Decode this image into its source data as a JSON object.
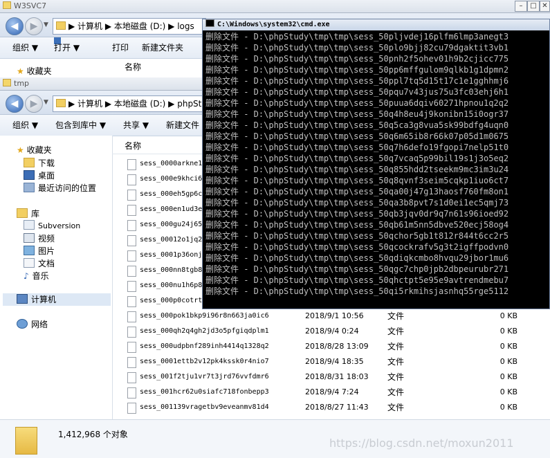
{
  "back_window": {
    "title": "W3SVC7",
    "address": "▶ 计算机 ▶ 本地磁盘 (D:) ▶ logs",
    "toolbar": {
      "organize": "组织 ▼",
      "open": "打开 ▼",
      "print": "打印",
      "new_folder": "新建文件夹"
    },
    "nav_favorites": "收藏夹",
    "col_name": "名称"
  },
  "front_window": {
    "title": "tmp",
    "address": "▶ 计算机 ▶ 本地磁盘 (D:) ▶ phpSt",
    "toolbar": {
      "organize": "组织 ▼",
      "include_lib": "包含到库中 ▼",
      "share": "共享 ▼",
      "new_folder": "新建文件"
    },
    "col_name": "名称",
    "nav": {
      "favorites": "收藏夹",
      "downloads": "下载",
      "desktop": "桌面",
      "recent": "最近访问的位置",
      "libraries": "库",
      "subversion": "Subversion",
      "videos": "视频",
      "pictures": "图片",
      "documents": "文档",
      "music": "音乐",
      "computer": "计算机",
      "network": "网络"
    },
    "rows": [
      {
        "name": "sess_0000arkne1",
        "date": "",
        "type": "",
        "size": ""
      },
      {
        "name": "sess_000e9khci6",
        "date": "",
        "type": "",
        "size": ""
      },
      {
        "name": "sess_000eh5gp6c",
        "date": "",
        "type": "",
        "size": ""
      },
      {
        "name": "sess_000en1ud3e",
        "date": "",
        "type": "",
        "size": ""
      },
      {
        "name": "sess_000gu24j65",
        "date": "",
        "type": "",
        "size": ""
      },
      {
        "name": "sess_00012o1jq2",
        "date": "",
        "type": "",
        "size": ""
      },
      {
        "name": "sess_0001p36onj",
        "date": "",
        "type": "",
        "size": ""
      },
      {
        "name": "sess_000nn8tgb8",
        "date": "",
        "type": "",
        "size": ""
      },
      {
        "name": "sess_000nu1h6p8",
        "date": "",
        "type": "",
        "size": ""
      },
      {
        "name": "sess_000p0cotrt",
        "date": "",
        "type": "",
        "size": ""
      },
      {
        "name": "sess_000pok1bkp9i96r8n663ja0ic6",
        "date": "2018/9/1 10:56",
        "type": "文件",
        "size": "0 KB"
      },
      {
        "name": "sess_000qh2q4gh2jd3o5pfgiqdplm1",
        "date": "2018/9/4 0:24",
        "type": "文件",
        "size": "0 KB"
      },
      {
        "name": "sess_000udpbnf289inh4414q1328q2",
        "date": "2018/8/28 13:09",
        "type": "文件",
        "size": "0 KB"
      },
      {
        "name": "sess_0001ettb2v12pk4kssk0r4nio7",
        "date": "2018/9/4 18:35",
        "type": "文件",
        "size": "0 KB"
      },
      {
        "name": "sess_001f2tju1vr7t3jrd76vvfdmr6",
        "date": "2018/8/31 18:03",
        "type": "文件",
        "size": "0 KB"
      },
      {
        "name": "sess_001hcr62u0siafc718fonbepp3",
        "date": "2018/9/4 7:24",
        "type": "文件",
        "size": "0 KB"
      },
      {
        "name": "sess_001139vragetbv9eveanmv81d4",
        "date": "2018/8/27 11:43",
        "type": "文件",
        "size": "0 KB"
      }
    ],
    "status_count": "1,412,968 个对象"
  },
  "cmd": {
    "title": "C:\\Windows\\system32\\cmd.exe",
    "lines": [
      "删除文件 - D:\\phpStudy\\tmp\\tmp\\sess_50pljvdej16plfm6lmp3anegt3",
      "删除文件 - D:\\phpStudy\\tmp\\tmp\\sess_50plo9bjj82cu79dgaktit3vb1",
      "删除文件 - D:\\phpStudy\\tmp\\tmp\\sess_50pnh2f5ohev01h9b2cjicc775",
      "删除文件 - D:\\phpStudy\\tmp\\tmp\\sess_50pp6mffgulom9qlkb1g1dpmn2",
      "删除文件 - D:\\phpStudy\\tmp\\tmp\\sess_50ppl7tq5d15t17c1e1gghhmj6",
      "删除文件 - D:\\phpStudy\\tmp\\tmp\\sess_50pqu7v43jus75u3fc03ehj6h1",
      "删除文件 - D:\\phpStudy\\tmp\\tmp\\sess_50puua6dqiv60271hpnou1q2q2",
      "删除文件 - D:\\phpStudy\\tmp\\tmp\\sess_50q4h8eu4j9konibn15i0ogr37",
      "删除文件 - D:\\phpStudy\\tmp\\tmp\\sess_50q5ca3g8vua5sk99bdfg4uqn0",
      "删除文件 - D:\\phpStudy\\tmp\\tmp\\sess_50q6m65ib8r66k07p05d1m0675",
      "删除文件 - D:\\phpStudy\\tmp\\tmp\\sess_50q7h6defo19fgopi7nelp51t0",
      "删除文件 - D:\\phpStudy\\tmp\\tmp\\sess_50q7vcaq5p99bil19s1j3o5eq2",
      "删除文件 - D:\\phpStudy\\tmp\\tmp\\sess_50q855hdd2tseekm9mc3im3u24",
      "删除文件 - D:\\phpStudy\\tmp\\tmp\\sess_50q8qvnf3seim5cqkp1iuo6ct7",
      "删除文件 - D:\\phpStudy\\tmp\\tmp\\sess_50qa00j47g13haosf760fm8on1",
      "删除文件 - D:\\phpStudy\\tmp\\tmp\\sess_50qa3b8pvt7s1d0ei1ec5qmj73",
      "删除文件 - D:\\phpStudy\\tmp\\tmp\\sess_50qb3jqv0dr9q7n61s96ioed92",
      "删除文件 - D:\\phpStudy\\tmp\\tmp\\sess_50qb61m5nn5dbve520ecj58og4",
      "删除文件 - D:\\phpStudy\\tmp\\tmp\\sess_50qchor5gb1t812r844t6cc2r5",
      "删除文件 - D:\\phpStudy\\tmp\\tmp\\sess_50qcockrafv5g3t2igffpodvn0",
      "删除文件 - D:\\phpStudy\\tmp\\tmp\\sess_50qdiqkcmbo8hvqu29jbor1mu6",
      "删除文件 - D:\\phpStudy\\tmp\\tmp\\sess_50qgc7chp0jpb2dbpeurubr271",
      "删除文件 - D:\\phpStudy\\tmp\\tmp\\sess_50qhctpt5e95e9avtrendmebu7",
      "删除文件 - D:\\phpStudy\\tmp\\tmp\\sess_50qi5rkmihsjasnhq55rge5112"
    ]
  },
  "watermark": "https://blog.csdn.net/moxun2011"
}
